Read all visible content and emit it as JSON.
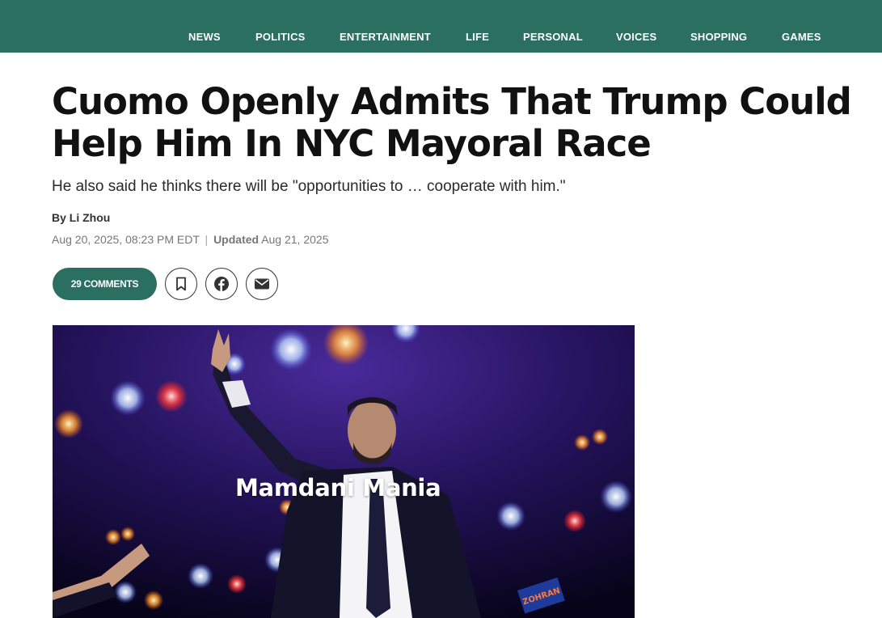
{
  "nav": {
    "items": [
      "NEWS",
      "POLITICS",
      "ENTERTAINMENT",
      "LIFE",
      "PERSONAL",
      "VOICES",
      "SHOPPING",
      "GAMES"
    ]
  },
  "article": {
    "headline": "Cuomo Openly Admits That Trump Could Help Him In NYC Mayoral Race",
    "dek": "He also said he thinks there will be \"opportunities to … cooperate with him.\"",
    "byline_prefix": "By",
    "author": "Li Zhou",
    "published": "Aug 20, 2025, 08:23 PM EDT",
    "separator": "|",
    "updated_label": "Updated",
    "updated": "Aug 21, 2025"
  },
  "actions": {
    "comments_label": "29 COMMENTS",
    "bookmark_icon": "bookmark-icon",
    "facebook_icon": "facebook-icon",
    "email_icon": "email-icon"
  },
  "hero": {
    "title": "Mamdani Mania",
    "sign_text": "ZOHRAN"
  },
  "colors": {
    "brand_green": "#2a6f5f",
    "nav_text": "#ffffff",
    "meta_gray": "#777777"
  }
}
